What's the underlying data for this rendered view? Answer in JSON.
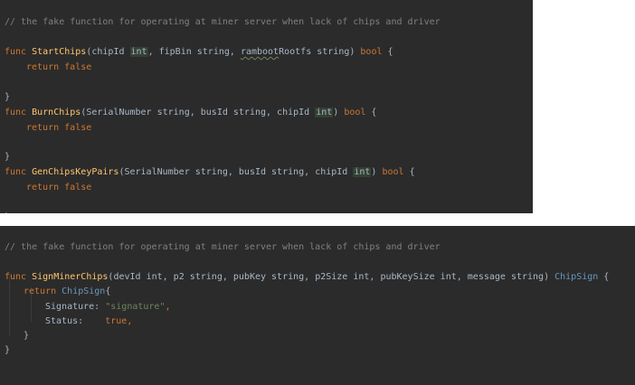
{
  "top": {
    "comment": "// the fake function for operating at miner server when lack of chips and driver",
    "funcs": [
      {
        "kw": "func",
        "name": "StartChips",
        "params_before": "(chipId ",
        "highlight": "int",
        "params_after_1": ", fipBin string, ",
        "typo_word": "ramboot",
        "params_after_2": "Rootfs string) ",
        "ret": "bool",
        "open": " {",
        "body_kw": "return",
        "body_val": "false",
        "close": "}"
      },
      {
        "kw": "func",
        "name": "BurnChips",
        "params_before": "(SerialNumber string, busId string, chipId ",
        "highlight": "int",
        "params_after": ") ",
        "ret": "bool",
        "open": " {",
        "body_kw": "return",
        "body_val": "false",
        "close": "}"
      },
      {
        "kw": "func",
        "name": "GenChipsKeyPairs",
        "params_before": "(SerialNumber string, busId string, chipId ",
        "highlight": "int",
        "params_after": ") ",
        "ret": "bool",
        "open": " {",
        "body_kw": "return",
        "body_val": "false",
        "close": "}"
      }
    ]
  },
  "bottom": {
    "comment": "// the fake function for operating at miner server when lack of chips and driver",
    "func_kw": "func",
    "func_name": "SignMinerChips",
    "params": "(devId int, p2 string, pubKey string, p2Size int, pubKeySize int, message string) ",
    "ret_type": "ChipSign",
    "open": " {",
    "return_kw": "return",
    "return_type": "ChipSign",
    "return_open": "{",
    "field1_name": "Signature:",
    "field1_value": "\"signature\"",
    "field1_comma": ",",
    "field2_name": "Status:",
    "field2_value": "true",
    "field2_comma": ",",
    "inner_close": "}",
    "outer_close": "}"
  }
}
